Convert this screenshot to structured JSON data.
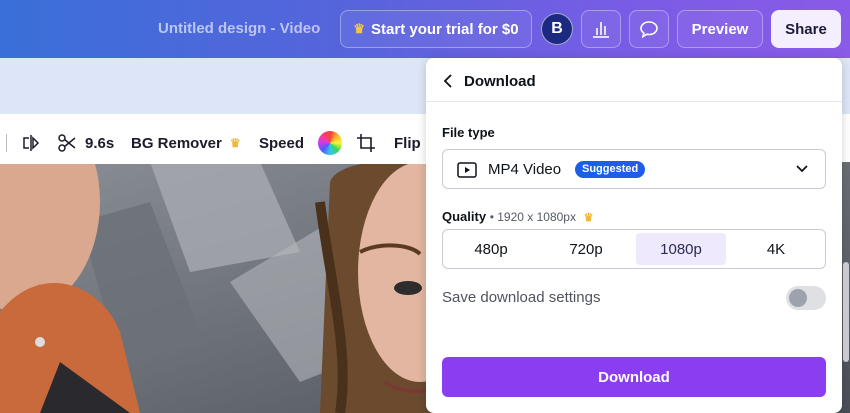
{
  "header": {
    "doc_title": "Untitled design - Video",
    "trial_label": "Start your trial for $0",
    "avatar_initial": "B",
    "preview_label": "Preview",
    "share_label": "Share",
    "icons": [
      "crown-icon",
      "bar-chart-icon",
      "comment-icon"
    ]
  },
  "toolbar": {
    "duration": "9.6s",
    "bg_remover": "BG Remover",
    "speed": "Speed",
    "flip": "Flip",
    "icons": [
      "flip-icon",
      "scissors-icon",
      "crown-icon",
      "color-wheel-icon",
      "crop-icon"
    ]
  },
  "download_panel": {
    "title": "Download",
    "file_type_label": "File type",
    "file_type_value": "MP4 Video",
    "file_type_badge": "Suggested",
    "quality_label": "Quality",
    "quality_detail": "• 1920 x 1080px",
    "quality_options": [
      "480p",
      "720p",
      "1080p",
      "4K"
    ],
    "quality_selected": "1080p",
    "save_settings_label": "Save download settings",
    "save_settings_on": false,
    "download_button": "Download"
  },
  "colors": {
    "accent": "#8b3df0",
    "badge": "#1b5fe8",
    "crown": "#f0b73a"
  }
}
